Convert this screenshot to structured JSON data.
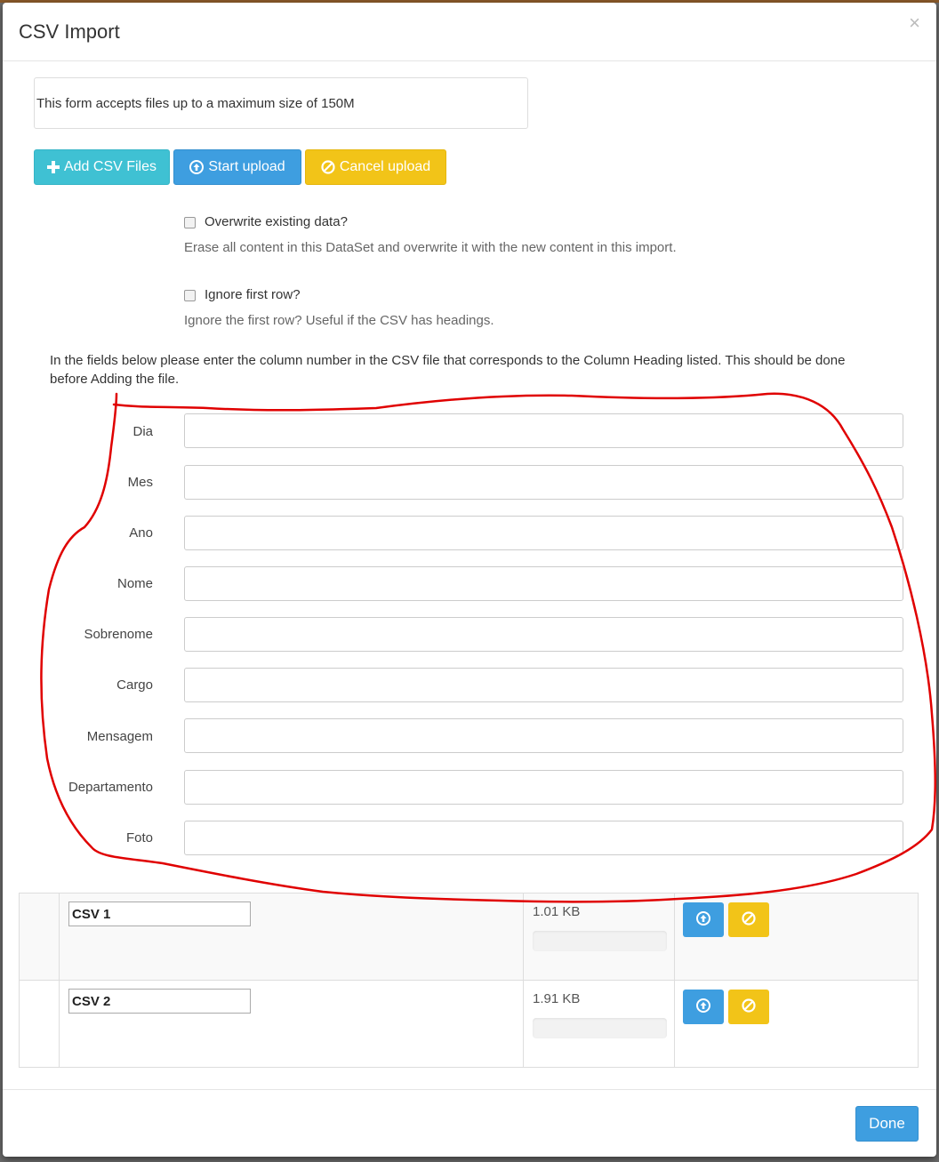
{
  "modal": {
    "title": "CSV Import",
    "close_glyph": "×"
  },
  "info": {
    "text": "This form accepts files up to a maximum size of 150M"
  },
  "toolbar": {
    "add_label": "Add CSV Files",
    "start_label": "Start upload",
    "cancel_label": "Cancel upload",
    "add_icon": "plus-icon",
    "start_icon": "upload-circle-icon",
    "cancel_icon": "ban-icon"
  },
  "options": {
    "overwrite": {
      "label": "Overwrite existing data?",
      "checked": false,
      "help": "Erase all content in this DataSet and overwrite it with the new content in this import."
    },
    "ignore_first_row": {
      "label": "Ignore first row?",
      "checked": false,
      "help": "Ignore the first row? Useful if the CSV has headings."
    }
  },
  "instructions": "In the fields below please enter the column number in the CSV file that corresponds to the Column Heading listed. This should be done before Adding the file.",
  "fields": [
    {
      "label": "Dia",
      "value": ""
    },
    {
      "label": "Mes",
      "value": ""
    },
    {
      "label": "Ano",
      "value": ""
    },
    {
      "label": "Nome",
      "value": ""
    },
    {
      "label": "Sobrenome",
      "value": ""
    },
    {
      "label": "Cargo",
      "value": ""
    },
    {
      "label": "Mensagem",
      "value": ""
    },
    {
      "label": "Departamento",
      "value": ""
    },
    {
      "label": "Foto",
      "value": ""
    }
  ],
  "files": [
    {
      "name": "CSV 1",
      "size": "1.01 KB",
      "progress": 0
    },
    {
      "name": "CSV 2",
      "size": "1.91 KB",
      "progress": 0
    }
  ],
  "footer": {
    "done_label": "Done"
  },
  "colors": {
    "info_blue": "#3fc1d3",
    "primary_blue": "#3e9ee0",
    "warning_yellow": "#f2c418",
    "annotation_red": "#e00000"
  }
}
